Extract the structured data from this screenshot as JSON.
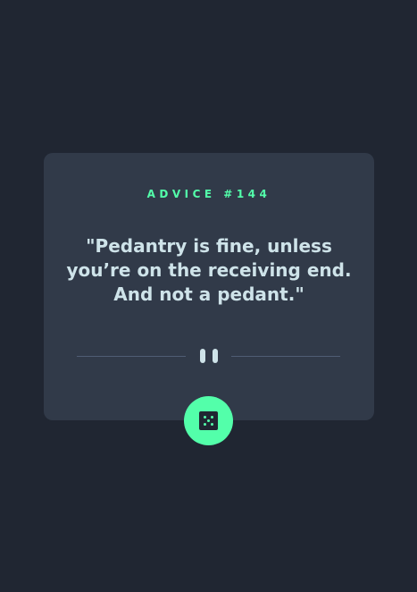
{
  "card": {
    "advice_id_label": "ADVICE #144",
    "advice_text": "\"Pedantry is fine, unless you’re on the receiving end. And not a pedant.\""
  },
  "button": {
    "icon": "dice-icon"
  },
  "colors": {
    "background": "#202632",
    "card": "#313a49",
    "accent": "#53ffaa",
    "text": "#cee3e9",
    "divider": "#4f5d74"
  }
}
